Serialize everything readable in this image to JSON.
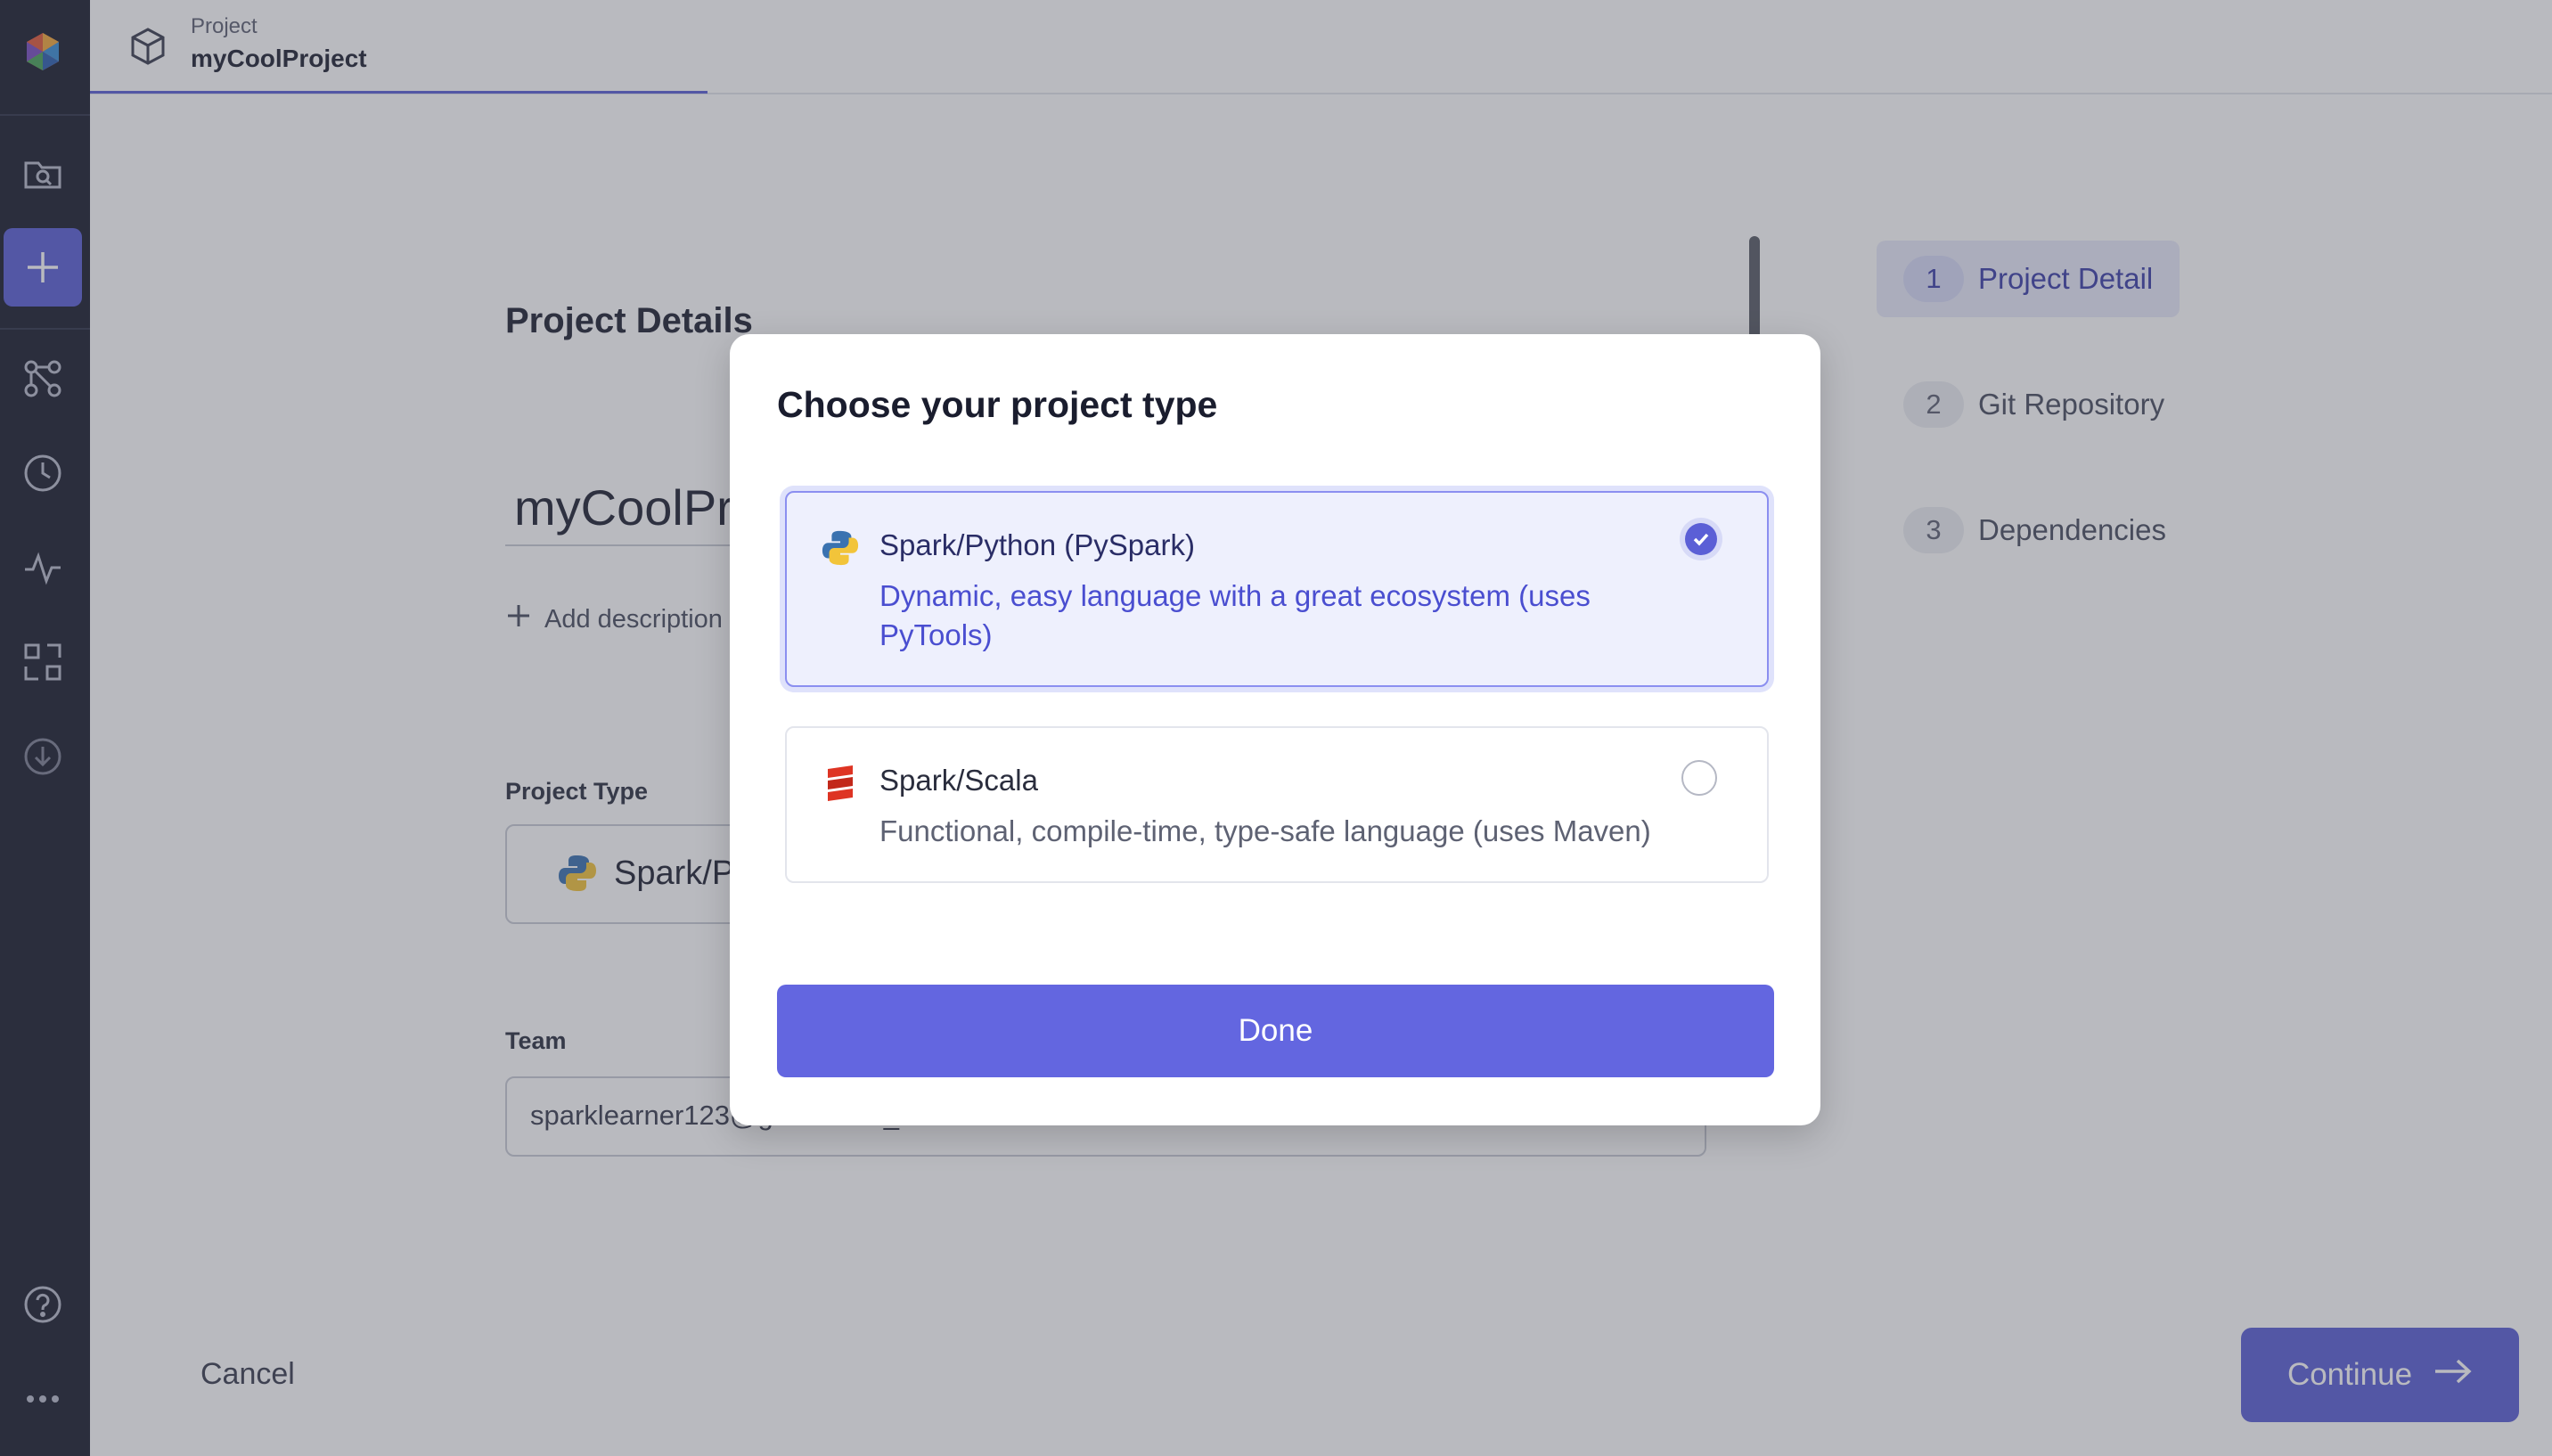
{
  "topbar": {
    "label": "Project",
    "name": "myCoolProject"
  },
  "sidebar": {
    "items": [
      {
        "icon": "logo-icon"
      },
      {
        "icon": "folder-search-icon"
      },
      {
        "icon": "plus-icon"
      },
      {
        "icon": "graph-nodes-icon"
      },
      {
        "icon": "clock-icon"
      },
      {
        "icon": "activity-icon"
      },
      {
        "icon": "layout-icon"
      },
      {
        "icon": "download-icon"
      },
      {
        "icon": "help-icon"
      },
      {
        "icon": "more-icon"
      }
    ]
  },
  "form": {
    "heading": "Project Details",
    "project_name": "myCoolProject",
    "add_description": "Add description",
    "project_type_label": "Project Type",
    "project_type_value": "Spark/Python (PySpark)",
    "team_label": "Team",
    "team_value": "sparklearner123@gmail.com_team"
  },
  "steps": [
    {
      "num": "1",
      "label": "Project Detail",
      "active": true
    },
    {
      "num": "2",
      "label": "Git Repository",
      "active": false
    },
    {
      "num": "3",
      "label": "Dependencies",
      "active": false
    }
  ],
  "footer": {
    "cancel": "Cancel",
    "continue": "Continue"
  },
  "modal": {
    "title": "Choose your project type",
    "options": [
      {
        "title": "Spark/Python (PySpark)",
        "description": "Dynamic, easy language with a great ecosystem (uses PyTools)",
        "selected": true
      },
      {
        "title": "Spark/Scala",
        "description": "Functional, compile-time, type-safe language (uses Maven)",
        "selected": false
      }
    ],
    "done": "Done"
  },
  "colors": {
    "accent": "#5b5fd6",
    "sidebar": "#1a1d2e",
    "selected_bg": "#eef0fd"
  }
}
